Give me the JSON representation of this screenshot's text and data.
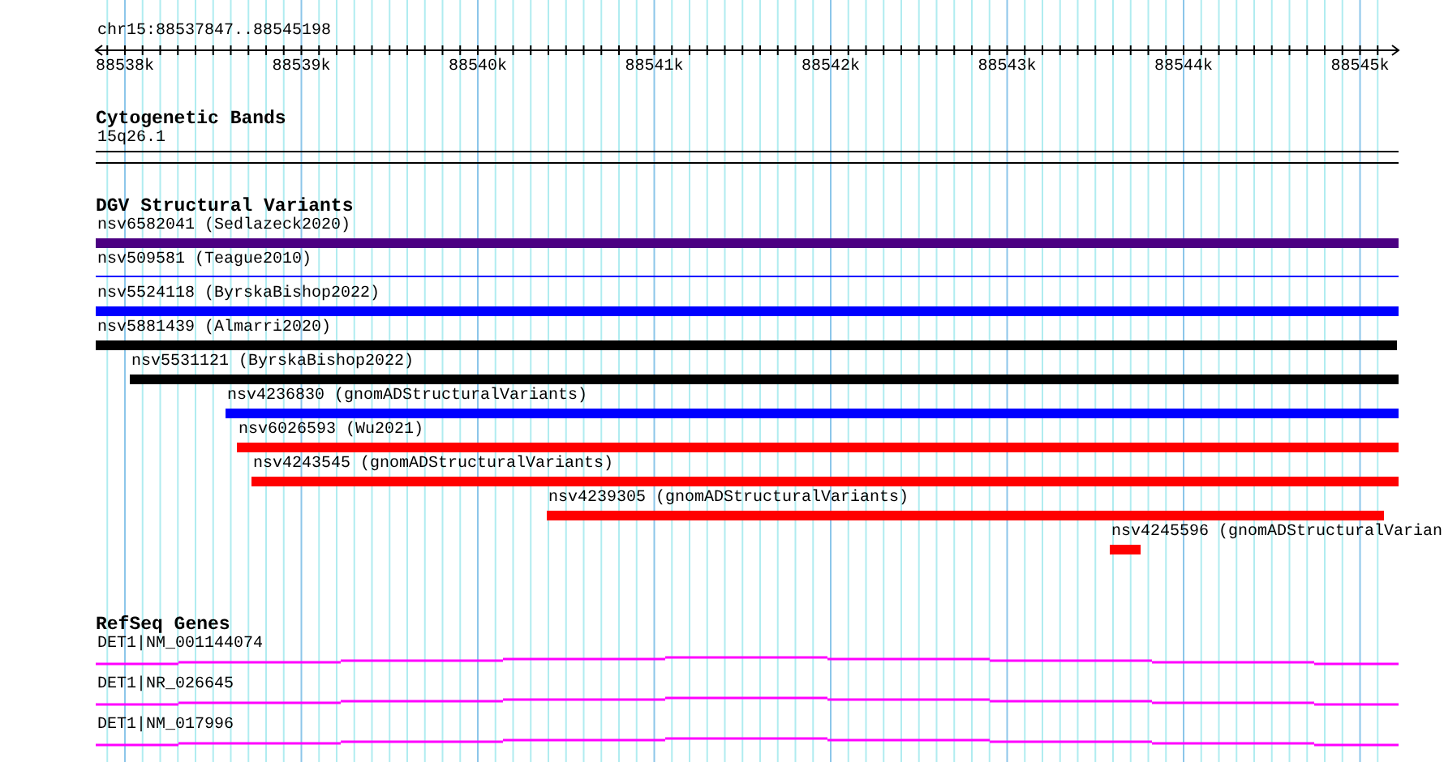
{
  "location": "chr15:88537847..88545198",
  "ruler": {
    "ticks": [
      "88538k",
      "88539k",
      "88540k",
      "88541k",
      "88542k",
      "88543k",
      "88544k",
      "88545k"
    ]
  },
  "tracks": [
    {
      "title": "Cytogenetic Bands",
      "kind": "bands",
      "features": [
        {
          "label": "15q26.1"
        }
      ]
    },
    {
      "title": "DGV Structural Variants",
      "kind": "variants",
      "features": [
        {
          "label": "nsv6582041 (Sedlazeck2020)",
          "kind": "bar",
          "color": "#4b0082"
        },
        {
          "label": "nsv509581 (Teague2010)",
          "kind": "line",
          "color": "#0000ff"
        },
        {
          "label": "nsv5524118 (ByrskaBishop2022)",
          "kind": "bar",
          "color": "#0000ff"
        },
        {
          "label": "nsv5881439 (Almarri2020)",
          "kind": "bar",
          "color": "#000000"
        },
        {
          "label": "nsv5531121 (ByrskaBishop2022)",
          "kind": "bar",
          "color": "#000000"
        },
        {
          "label": "nsv4236830 (gnomADStructuralVariants)",
          "kind": "bar",
          "color": "#0000ff"
        },
        {
          "label": "nsv6026593 (Wu2021)",
          "kind": "bar",
          "color": "#ff0000"
        },
        {
          "label": "nsv4243545 (gnomADStructuralVariants)",
          "kind": "bar",
          "color": "#ff0000"
        },
        {
          "label": "nsv4239305 (gnomADStructuralVariants)",
          "kind": "bar",
          "color": "#ff0000"
        },
        {
          "label": "nsv4245596 (gnomADStructuralVarian",
          "kind": "bar",
          "color": "#ff0000"
        }
      ]
    },
    {
      "title": "RefSeq Genes",
      "kind": "genes",
      "features": [
        {
          "label": "DET1|NM_001144074"
        },
        {
          "label": "DET1|NR_026645"
        },
        {
          "label": "DET1|NM_017996"
        }
      ]
    }
  ]
}
